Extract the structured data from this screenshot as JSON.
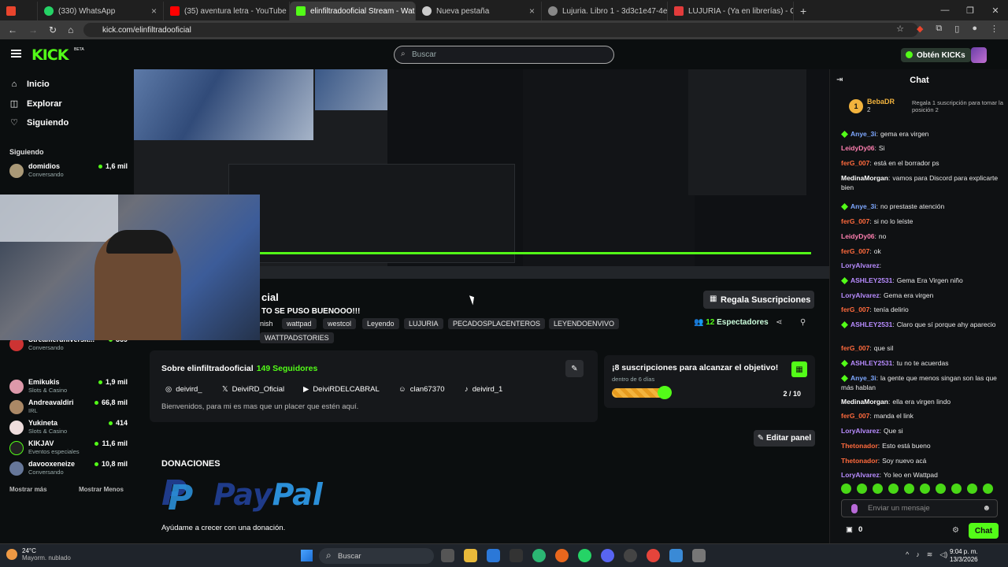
{
  "tabs": [
    {
      "label": "",
      "color": "#e9452d"
    },
    {
      "label": "(330) WhatsApp",
      "color": "#25d366"
    },
    {
      "label": "(35) aventura letra - YouTube",
      "color": "#ff0000"
    },
    {
      "label": "elinfiltradooficial Stream - Wat",
      "color": "#53fc18"
    },
    {
      "label": "Nueva pestaña",
      "color": "#cccccc"
    },
    {
      "label": "Lujuria. Libro 1 - 3d3c1e47-4e6",
      "color": "#cccccc"
    },
    {
      "label": "LUJURIA - (Ya en librerías) - CA",
      "color": "#e23b3b"
    }
  ],
  "url": "kick.com/elinfiltradooficial",
  "brand": {
    "logo": "KICK",
    "beta": "BETA",
    "accent": "#53fc18"
  },
  "search": {
    "placeholder": "Buscar"
  },
  "get_kicks": "Obtén KICKs",
  "nav": [
    {
      "label": "Inicio",
      "icon": "home-icon"
    },
    {
      "label": "Explorar",
      "icon": "compass-icon"
    },
    {
      "label": "Siguiendo",
      "icon": "heart-icon"
    }
  ],
  "following_heading": "Siguiendo",
  "following": [
    {
      "name": "domidios",
      "sub": "Conversando",
      "count": "1,6 mil"
    },
    {
      "name": "Streameruniversit...",
      "sub": "Conversando",
      "count": "369"
    },
    {
      "name": "Emikukis",
      "sub": "Slots & Casino",
      "count": "1,9 mil"
    },
    {
      "name": "Andreavaldiri",
      "sub": "IRL",
      "count": "66,8 mil"
    },
    {
      "name": "Yukineta",
      "sub": "Slots & Casino",
      "count": "414"
    },
    {
      "name": "KIKJAV",
      "sub": "Eventos especiales",
      "count": "11,6 mil"
    },
    {
      "name": "davooxeneize",
      "sub": "Conversando",
      "count": "10,8 mil"
    }
  ],
  "show_more": "Mostrar más",
  "show_less": "Mostrar Menos",
  "stream": {
    "title_tail": "cial",
    "subtitle": "TO SE PUSO BUENOOO!!!",
    "tags": [
      "nish",
      "wattpad",
      "westcol",
      "Leyendo",
      "LUJURIA",
      "PECADOSPLACENTEROS",
      "LEYENDOENVIVO",
      "WATTPADSTORIES"
    ],
    "gift_button": "Regala Suscripciones",
    "viewers_count": "12",
    "viewers_label": "Espectadores"
  },
  "about": {
    "title": "Sobre elinfiltradooficial",
    "followers": "149 Seguidores",
    "socials": [
      {
        "icon": "instagram-icon",
        "label": "deivird_"
      },
      {
        "icon": "x-icon",
        "label": "DeiviRD_Oficial"
      },
      {
        "icon": "youtube-icon",
        "label": "DeiviRDELCABRAL"
      },
      {
        "icon": "discord-icon",
        "label": "clan67370"
      },
      {
        "icon": "tiktok-icon",
        "label": "deivird_1"
      }
    ],
    "description": "Bienvenidos, para mi es mas que un placer que estén aquí."
  },
  "goal": {
    "title": "¡8 suscripciones para alcanzar el objetivo!",
    "due": "dentro de 6 días",
    "progress": "2 / 10",
    "fraction": 0.2
  },
  "edit_panel": "Editar panel",
  "donations": {
    "heading": "DONACIONES",
    "paypal_1": "Pay",
    "paypal_2": "Pal",
    "note": "Ayúdame a crecer con una donación."
  },
  "chat": {
    "title": "Chat",
    "pinned": {
      "rank": "1",
      "user": "BebaDR",
      "amount": "2",
      "message": "Regala 1 suscripción para tomar la posición 2"
    },
    "messages": [
      {
        "user": "Anye_3i",
        "text": "gema era virgen",
        "color": "#7ea8ff",
        "badge": true
      },
      {
        "user": "LeidyDy06",
        "text": "Si",
        "color": "#ff7fb0",
        "badge": false
      },
      {
        "user": "ferG_007",
        "text": "está en el borrador ps",
        "color": "#ff6a3d",
        "badge": false
      },
      {
        "user": "MedinaMorgan",
        "text": "vamos para Discord para explicarte bien",
        "color": "#ffffff",
        "badge": false
      },
      {
        "user": "Anye_3i",
        "text": "no prestaste atención",
        "color": "#7ea8ff",
        "badge": true
      },
      {
        "user": "ferG_007",
        "text": "si no lo leíste",
        "color": "#ff6a3d",
        "badge": false
      },
      {
        "user": "LeidyDy06",
        "text": "no",
        "color": "#ff7fb0",
        "badge": false
      },
      {
        "user": "ferG_007",
        "text": "ok",
        "color": "#ff6a3d",
        "badge": false
      },
      {
        "user": "LoryAlvarez",
        "text": "",
        "color": "#b88cff",
        "badge": false
      },
      {
        "user": "ASHLEY2531",
        "text": "Gema Era Virgen niño",
        "color": "#b88cff",
        "badge": true
      },
      {
        "user": "LoryAlvarez",
        "text": "Gema era virgen",
        "color": "#b88cff",
        "badge": false
      },
      {
        "user": "ferG_007",
        "text": "tenía delirio",
        "color": "#ff6a3d",
        "badge": false
      },
      {
        "user": "ASHLEY2531",
        "text": "Claro que sí porque ahy aparecio",
        "color": "#b88cff",
        "badge": true
      },
      {
        "user": "ferG_007",
        "text": "que sil",
        "color": "#ff6a3d",
        "badge": false
      },
      {
        "user": "ASHLEY2531",
        "text": "tu no te acuerdas",
        "color": "#b88cff",
        "badge": true
      },
      {
        "user": "Anye_3i",
        "text": "la gente que menos singan son las que más hablan",
        "color": "#7ea8ff",
        "badge": true
      },
      {
        "user": "MedinaMorgan",
        "text": "ella era virgen lindo",
        "color": "#ffffff",
        "badge": false
      },
      {
        "user": "ferG_007",
        "text": "manda el link",
        "color": "#ff6a3d",
        "badge": false
      },
      {
        "user": "LoryAlvarez",
        "text": "Que si",
        "color": "#b88cff",
        "badge": false
      },
      {
        "user": "Thetonador",
        "text": "Esto está bueno",
        "color": "#ff6a3d",
        "badge": false
      },
      {
        "user": "Thetonador",
        "text": "Soy nuevo acá",
        "color": "#ff6a3d",
        "badge": false
      },
      {
        "user": "LoryAlvarez",
        "text": "Yo leo en Wattpad",
        "color": "#b88cff",
        "badge": false
      }
    ],
    "input_placeholder": "Enviar un mensaje",
    "kicks_count": "0",
    "send_label": "Chat"
  },
  "taskbar": {
    "temp": "24°C",
    "weather": "Mayorm. nublado",
    "search": "Buscar",
    "time": "9:04 p. m.",
    "date": "13/3/2026"
  }
}
